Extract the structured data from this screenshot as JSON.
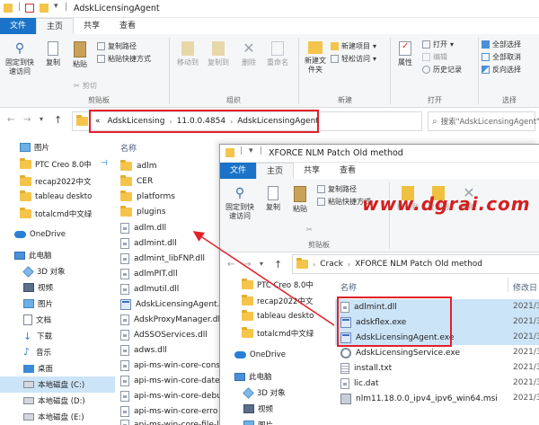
{
  "back_window": {
    "title": "AdskLicensingAgent",
    "tabs": [
      "文件",
      "主页",
      "共享",
      "查看"
    ],
    "ribbon": {
      "pin_label": "固定到快速访问",
      "copy_label": "复制",
      "paste_label": "粘贴",
      "copy_path": "复制路径",
      "paste_shortcut": "粘贴快捷方式",
      "cut": "剪切",
      "move_to": "移动到",
      "copy_to": "复制到",
      "delete": "删除",
      "rename": "重命名",
      "new_folder": "新建文件夹",
      "new_item": "新建项目",
      "easy_access": "轻松访问",
      "properties": "属性",
      "open": "打开",
      "edit": "编辑",
      "history": "历史记录",
      "select_all": "全部选择",
      "select_none": "全部取消",
      "invert_selection": "反向选择",
      "group_clipboard": "剪贴板",
      "group_organize": "组织",
      "group_new": "新建",
      "group_open": "打开",
      "group_select": "选择"
    },
    "address": {
      "prefix": "«",
      "crumbs": [
        "AdskLicensing",
        "11.0.0.4854",
        "AdskLicensingAgent"
      ],
      "search_placeholder": "搜索\"AdskLicensingAgent\""
    },
    "column_name": "名称",
    "nav": [
      "图片",
      "PTC Creo 8.0中",
      "recap2022中文",
      "tableau deskto",
      "totalcmd中文绿",
      "OneDrive",
      "此电脑",
      "3D 对象",
      "视频",
      "图片",
      "文档",
      "下载",
      "音乐",
      "桌面",
      "本地磁盘 (C:)",
      "本地磁盘 (D:)",
      "本地磁盘 (E:)"
    ],
    "files": [
      "adlm",
      "CER",
      "platforms",
      "plugins",
      "adlm.dll",
      "adlmint.dll",
      "adlmint_libFNP.dll",
      "adlmPIT.dll",
      "adlmutil.dll",
      "AdskLicensingAgent.e",
      "AdskProxyManager.dl",
      "AdSSOServices.dll",
      "adws.dll",
      "api-ms-win-core-cons",
      "api-ms-win-core-date",
      "api-ms-win-core-debu",
      "api-ms-win-core-erro",
      "api-ms-win-core-file-l"
    ]
  },
  "front_window": {
    "title": "XFORCE NLM Patch Old method",
    "tabs": [
      "文件",
      "主页",
      "共享",
      "查看"
    ],
    "ribbon": {
      "pin_label": "固定到快速访问",
      "copy_label": "复制",
      "paste_label": "粘贴",
      "copy_path": "复制路径",
      "paste_shortcut": "粘贴快捷方式",
      "move_to": "移动到",
      "copy_to": "复制到",
      "delete": "删除",
      "group_clipboard": "剪贴板"
    },
    "address": {
      "crumbs": [
        "Crack",
        "XFORCE NLM Patch Old method"
      ]
    },
    "column_name": "名称",
    "column_date": "修改日",
    "nav": [
      "PTC Creo 8.0中",
      "recap2022中文",
      "tableau deskto",
      "totalcmd中文绿",
      "OneDrive",
      "此电脑",
      "3D 对象",
      "视频",
      "图片"
    ],
    "files": [
      {
        "name": "adlmint.dll",
        "date": "2021/3"
      },
      {
        "name": "adskflex.exe",
        "date": "2021/3"
      },
      {
        "name": "AdskLicensingAgent.exe",
        "date": "2021/3"
      },
      {
        "name": "AdskLicensingService.exe",
        "date": "2021/3"
      },
      {
        "name": "install.txt",
        "date": "2021/3"
      },
      {
        "name": "lic.dat",
        "date": "2021/3"
      },
      {
        "name": "nlm11.18.0.0_ipv4_ipv6_win64.msi",
        "date": "2021/3"
      }
    ]
  },
  "watermark": "www.dgrai.com",
  "colors": {
    "accent": "#1a73c8",
    "highlight": "#e2202a",
    "selection": "#cce4f7"
  }
}
